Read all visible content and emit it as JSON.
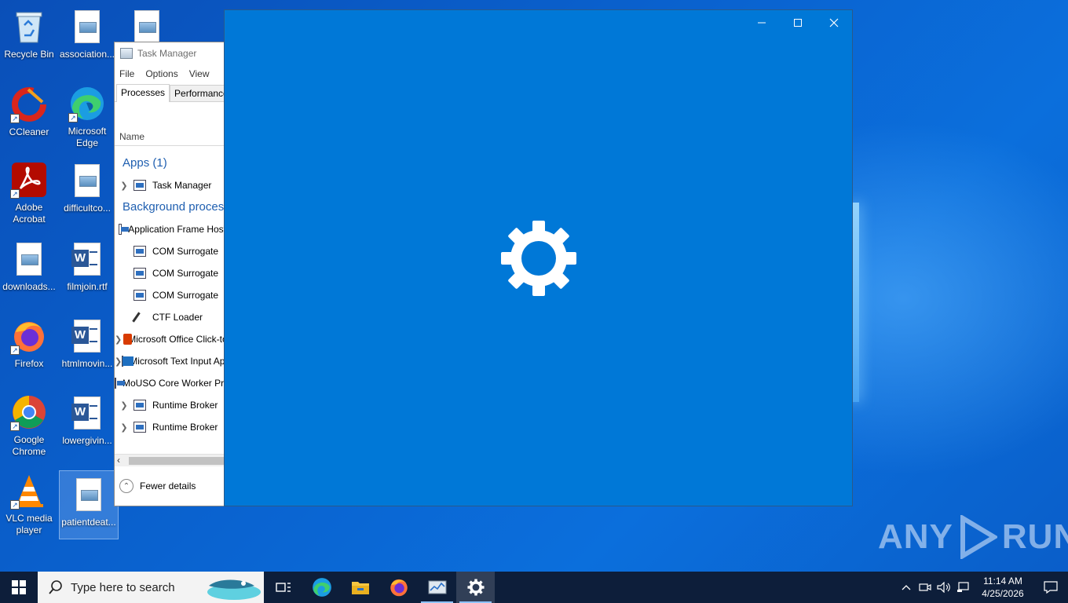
{
  "desktop": {
    "icons": [
      {
        "label": "Recycle Bin",
        "icon": "recycle-bin-icon"
      },
      {
        "label": "association...",
        "icon": "image-file-icon"
      },
      {
        "label": "",
        "icon": "image-file-icon"
      },
      {
        "label": "CCleaner",
        "icon": "ccleaner-icon"
      },
      {
        "label": "Microsoft Edge",
        "icon": "edge-icon"
      },
      {
        "label": "Adobe Acrobat",
        "icon": "acrobat-icon"
      },
      {
        "label": "difficultco...",
        "icon": "image-file-icon"
      },
      {
        "label": "downloads...",
        "icon": "image-file-icon"
      },
      {
        "label": "filmjoin.rtf",
        "icon": "word-doc-icon"
      },
      {
        "label": "Firefox",
        "icon": "firefox-icon"
      },
      {
        "label": "htmlmovin...",
        "icon": "word-doc-icon"
      },
      {
        "label": "Google Chrome",
        "icon": "chrome-icon"
      },
      {
        "label": "lowergivin...",
        "icon": "word-doc-icon"
      },
      {
        "label": "VLC media player",
        "icon": "vlc-icon"
      },
      {
        "label": "patientdeat...",
        "icon": "image-file-icon"
      }
    ]
  },
  "taskmgr": {
    "title": "Task Manager",
    "menu": [
      "File",
      "Options",
      "View"
    ],
    "tabs": [
      "Processes",
      "Performance"
    ],
    "column_name": "Name",
    "group_apps": "Apps (1)",
    "app_rows": [
      {
        "name": "Task Manager",
        "expandable": true,
        "icon": "task-manager-icon"
      }
    ],
    "group_background": "Background processes",
    "bg_rows": [
      {
        "name": "Application Frame Host",
        "expandable": false,
        "icon": "window-icon"
      },
      {
        "name": "COM Surrogate",
        "expandable": false,
        "icon": "window-icon"
      },
      {
        "name": "COM Surrogate",
        "expandable": false,
        "icon": "window-icon"
      },
      {
        "name": "COM Surrogate",
        "expandable": false,
        "icon": "window-icon"
      },
      {
        "name": "CTF Loader",
        "expandable": false,
        "icon": "ctf-icon"
      },
      {
        "name": "Microsoft Office Click-to-Run",
        "expandable": true,
        "icon": "office-icon"
      },
      {
        "name": "Microsoft Text Input Application",
        "expandable": true,
        "icon": "text-input-icon"
      },
      {
        "name": "MoUSO Core Worker Process",
        "expandable": false,
        "icon": "window-icon"
      },
      {
        "name": "Runtime Broker",
        "expandable": true,
        "icon": "window-icon"
      },
      {
        "name": "Runtime Broker",
        "expandable": true,
        "icon": "window-icon"
      }
    ],
    "fewer_details": "Fewer details"
  },
  "settings_window": {
    "background": "#0078d7",
    "icon": "gear-icon"
  },
  "watermark": {
    "left": "ANY",
    "right": "RUN"
  },
  "taskbar": {
    "search_placeholder": "Type here to search",
    "apps": [
      "task-view-icon",
      "edge-icon",
      "file-explorer-icon",
      "firefox-icon",
      "task-manager-icon",
      "settings-icon"
    ],
    "clock_time": "11:14 AM",
    "clock_date": "4/25/2026"
  }
}
